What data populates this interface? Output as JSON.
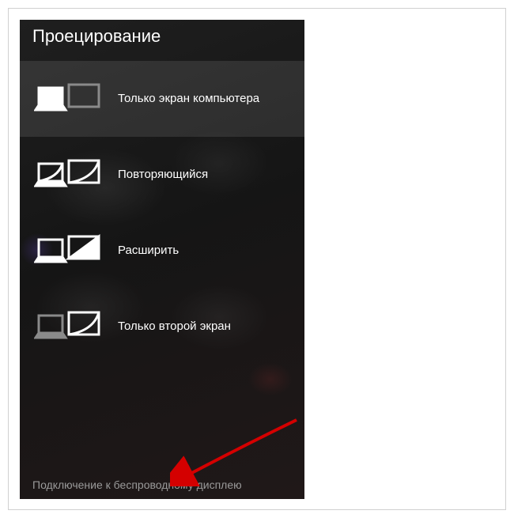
{
  "title": "Проецирование",
  "options": [
    {
      "label": "Только экран компьютера"
    },
    {
      "label": "Повторяющийся"
    },
    {
      "label": "Расширить"
    },
    {
      "label": "Только второй экран"
    }
  ],
  "wireless_link": "Подключение к беспроводному дисплею",
  "colors": {
    "arrow": "#d40000"
  }
}
